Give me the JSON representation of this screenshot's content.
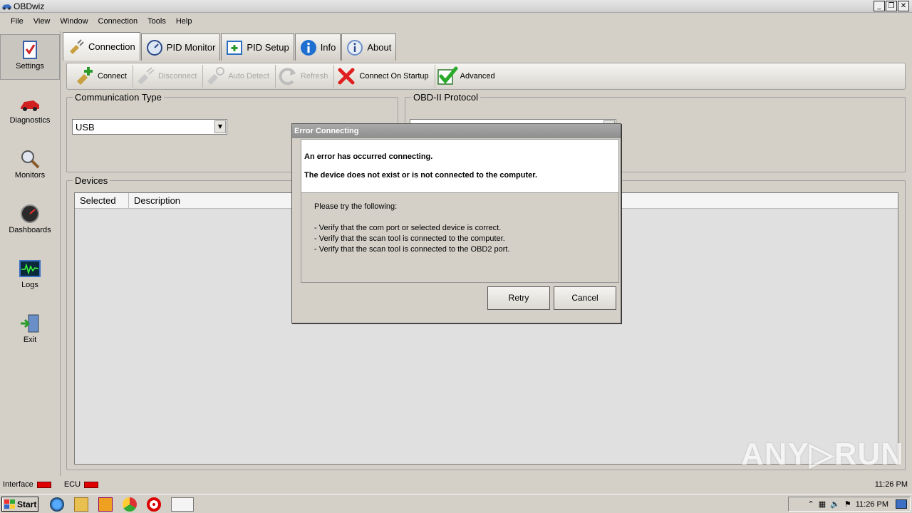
{
  "window": {
    "title": "OBDwiz",
    "min": "_",
    "restore": "❐",
    "close": "✕"
  },
  "menu": [
    "File",
    "View",
    "Window",
    "Connection",
    "Tools",
    "Help"
  ],
  "sidebar": [
    {
      "label": "Settings",
      "icon": "checklist-icon"
    },
    {
      "label": "Diagnostics",
      "icon": "car-icon"
    },
    {
      "label": "Monitors",
      "icon": "magnifier-icon"
    },
    {
      "label": "Dashboards",
      "icon": "gauge-icon"
    },
    {
      "label": "Logs",
      "icon": "waveform-icon"
    },
    {
      "label": "Exit",
      "icon": "exit-door-icon"
    }
  ],
  "tabs": [
    "Connection",
    "PID Monitor",
    "PID Setup",
    "Info",
    "About"
  ],
  "toolbar": {
    "connect": "Connect",
    "disconnect": "Disconnect",
    "auto_detect": "Auto Detect",
    "refresh": "Refresh",
    "connect_on_startup": "Connect On Startup",
    "advanced": "Advanced"
  },
  "comm": {
    "legend": "Communication Type",
    "value": "USB"
  },
  "protocol": {
    "legend": "OBD-II Protocol"
  },
  "devices": {
    "legend": "Devices",
    "columns": [
      "Selected",
      "Description"
    ]
  },
  "status": {
    "interface": "Interface",
    "ecu": "ECU",
    "time": "11:26 PM",
    "led_color": "#e00000"
  },
  "taskbar": {
    "start": "Start",
    "time": "11:26 PM"
  },
  "dialog": {
    "title": "Error Connecting",
    "line1": "An error has occurred connecting.",
    "line2": "The device does not exist or is not connected to the computer.",
    "intro": "Please try the following:",
    "tips": [
      "- Verify that the com port or selected device is correct.",
      "- Verify that the scan tool is connected to the computer.",
      "- Verify that the scan tool is connected to the OBD2 port."
    ],
    "retry": "Retry",
    "cancel": "Cancel"
  },
  "watermark": "ANY▷RUN"
}
